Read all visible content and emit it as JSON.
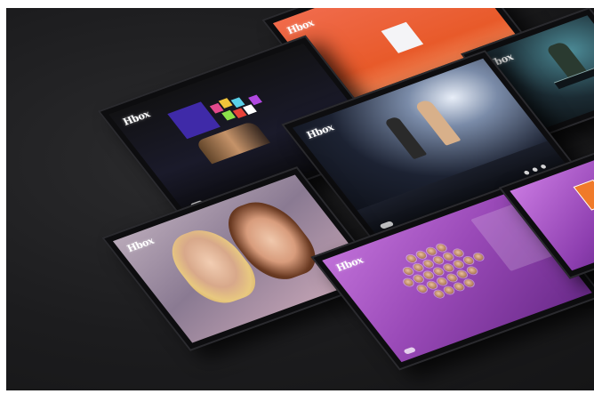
{
  "scene": {
    "background": "#1c1c1e",
    "frame": "#ffffff"
  },
  "tablets": {
    "stage_mosaic": {
      "logo": "Hbox",
      "accent": "#3f2aa8"
    },
    "stage_concert": {
      "logo": "Hbox",
      "accent": "#c9d6ea"
    },
    "stage_keyboard": {
      "logo": "Hbox",
      "accent": "#3a6a7a"
    },
    "top_orange": {
      "logo": "Hbox",
      "accent": "#ef6a3a"
    },
    "portrait": {
      "logo": "Hbox",
      "accent": "#d9b8a0"
    },
    "face_grid": {
      "logo": "Hbox",
      "accent": "#9a4ab8"
    },
    "right_purple": {
      "logo": "",
      "accent": "#8e3fb0"
    }
  }
}
